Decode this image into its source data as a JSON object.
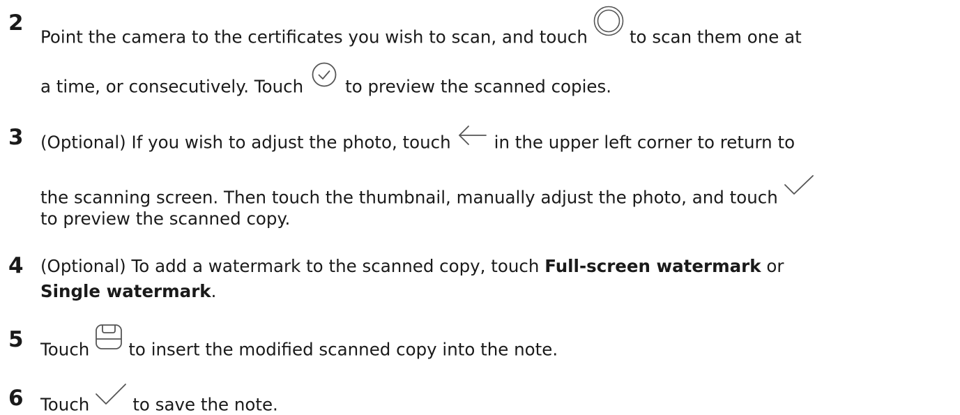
{
  "steps": [
    {
      "number": "2",
      "line1_before": "Point the camera to the certificates you wish to scan, and touch",
      "line1_after": "to scan them one at",
      "line2_before": "a time, or consecutively. Touch",
      "line2_after": "to preview the scanned copies.",
      "icons": [
        "shutter-circle-icon",
        "check-circle-icon"
      ]
    },
    {
      "number": "3",
      "line1_before": "(Optional) If you wish to adjust the photo, touch",
      "line1_after": "in the upper left corner to return to",
      "line2_before": "the scanning screen. Then touch the thumbnail, manually adjust the photo, and touch",
      "line3": "to preview the scanned copy.",
      "icons": [
        "back-arrow-icon",
        "checkmark-icon"
      ]
    },
    {
      "number": "4",
      "line1_before": "(Optional) To add a watermark to the scanned copy, touch",
      "line1_bold": "Full-screen watermark",
      "line1_after": "or",
      "line2_bold": "Single watermark",
      "line2_after": "."
    },
    {
      "number": "5",
      "line1_before": "Touch",
      "line1_after": "to insert the modified scanned copy into the note.",
      "icons": [
        "save-icon"
      ]
    },
    {
      "number": "6",
      "line1_before": "Touch",
      "line1_after": "to save the note.",
      "icons": [
        "checkmark-icon"
      ]
    }
  ]
}
